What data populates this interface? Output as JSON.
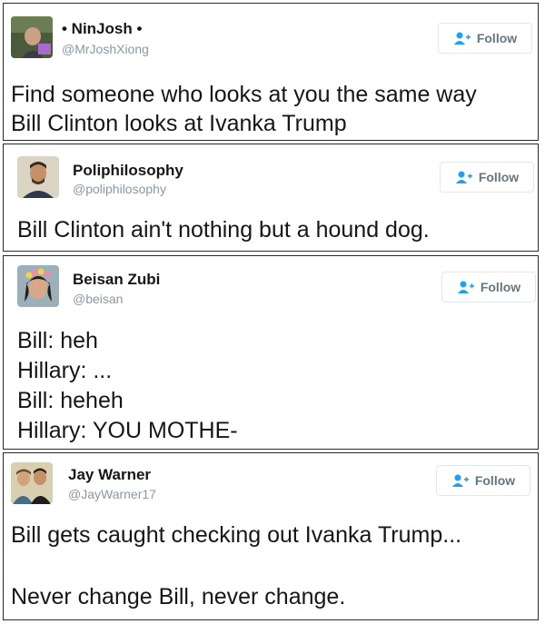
{
  "colors": {
    "follow_icon": "#1da1f2",
    "handle": "#8899a6",
    "border": "#2b2b2b"
  },
  "tweets": [
    {
      "name": "• NinJosh •",
      "handle": "@MrJoshXiong",
      "follow_label": "Follow",
      "lines": [
        "Find someone who looks at you the same way",
        "Bill Clinton looks at Ivanka Trump"
      ]
    },
    {
      "name": "Poliphilosophy",
      "handle": "@poliphilosophy",
      "follow_label": "Follow",
      "lines": [
        "Bill Clinton ain't nothing but a hound dog."
      ]
    },
    {
      "name": "Beisan Zubi",
      "handle": "@beisan",
      "follow_label": "Follow",
      "lines": [
        "Bill: heh",
        "Hillary: ...",
        "Bill: heheh",
        "Hillary: YOU MOTHE-"
      ]
    },
    {
      "name": "Jay Warner",
      "handle": "@JayWarner17",
      "follow_label": "Follow",
      "lines": [
        "Bill gets caught checking out Ivanka Trump...",
        "",
        "Never change Bill, never change."
      ]
    }
  ]
}
